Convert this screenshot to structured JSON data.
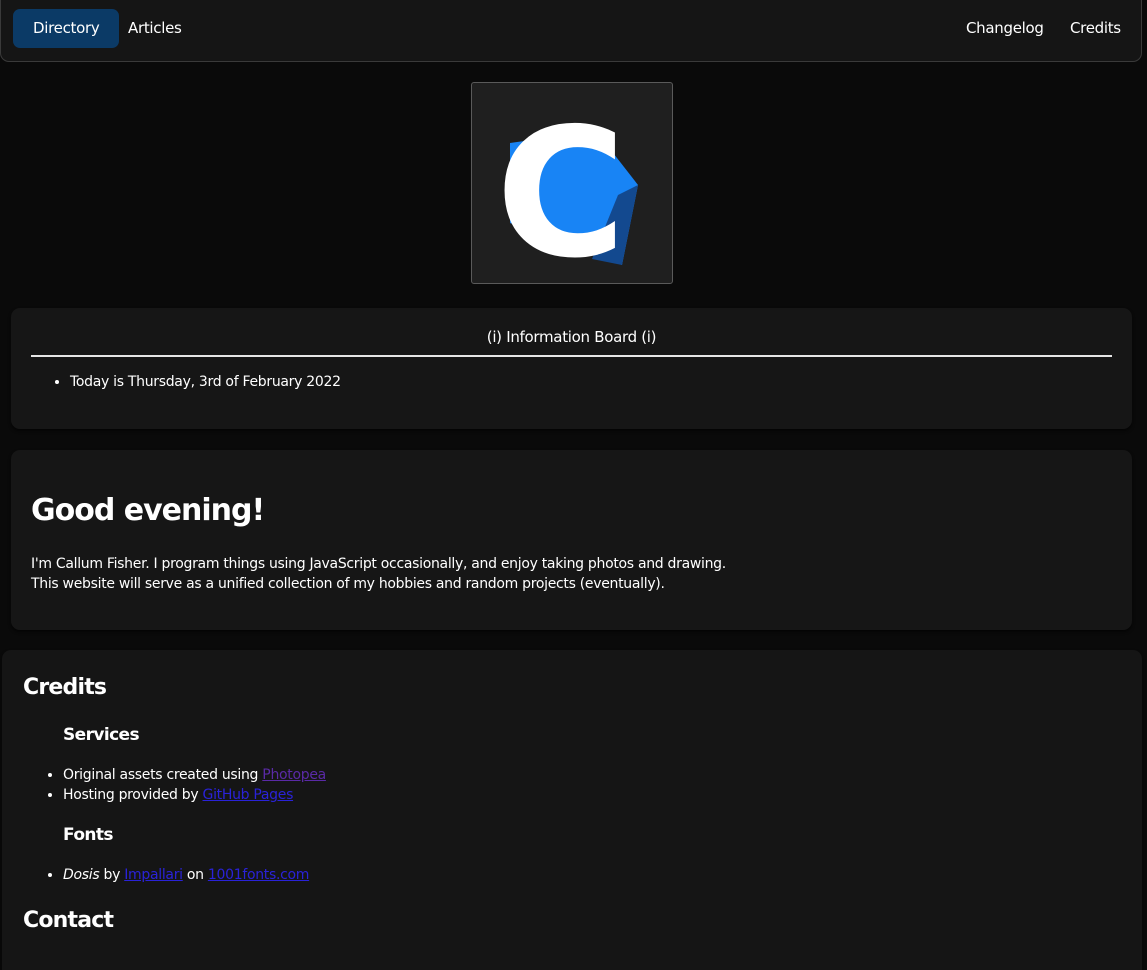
{
  "nav": {
    "left": [
      "Directory",
      "Articles"
    ],
    "right": [
      "Changelog",
      "Credits"
    ],
    "active": "Directory"
  },
  "logo": {
    "letter": "C",
    "colors": {
      "letter": "#ffffff",
      "shape_light": "#1884f5",
      "shape_dark": "#13498f",
      "box": "#1f1f1f"
    }
  },
  "info_board": {
    "title": "(i) Information Board (i)",
    "items": [
      "Today is Thursday, 3rd of February 2022"
    ]
  },
  "greeting": {
    "title": "Good evening!",
    "line1": "I'm Callum Fisher. I program things using JavaScript occasionally, and enjoy taking photos and drawing.",
    "line2": "This website will serve as a unified collection of my hobbies and random projects (eventually)."
  },
  "credits": {
    "title": "Credits",
    "services_title": "Services",
    "services": [
      {
        "prefix": "Original assets created using ",
        "link": "Photopea"
      },
      {
        "prefix": "Hosting provided by ",
        "link": "GitHub Pages"
      }
    ],
    "fonts_title": "Fonts",
    "font_entry": {
      "font": "Dosis",
      "by": " by ",
      "author": "Impallari",
      "on": " on ",
      "site": "1001fonts.com"
    }
  },
  "contact": {
    "title": "Contact"
  },
  "colors": {
    "accent": "#0b3a66",
    "background": "#0a0a0a",
    "panel": "#161616",
    "link": "#2a22d8",
    "link_visited": "#5a2aa6"
  }
}
